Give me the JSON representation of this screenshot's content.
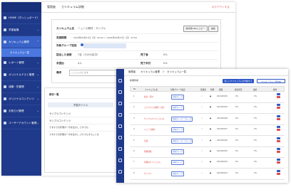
{
  "back_window": {
    "sidebar": {
      "items": [
        {
          "label": "HOME（ダッシュボード）"
        },
        {
          "label": "学習者機"
        },
        {
          "label": "カリキュラム管理"
        },
        {
          "label": "レポート管理"
        },
        {
          "label": "オリジナルテスト管理"
        },
        {
          "label": "成績・先管理"
        },
        {
          "label": "オリジナルコンテンツ"
        },
        {
          "label": "お知らせ管理"
        },
        {
          "label": "ユーザーアカウント管理"
        }
      ],
      "sub_item": "カリキュラム一覧"
    },
    "header": {
      "breadcrumb": "管理者　　カリキュラム詳細",
      "logout": "ログアウトする"
    },
    "detail": {
      "curriculum_name_label": "カリキュラム名",
      "curriculum_name_value": "ニュース教材・サンプル",
      "period_label": "実施期間",
      "period_value": "2024年09月27日（日）00:00 ～ 2024年10月27日（日）23:59",
      "group_label": "対象グループ設定",
      "group_value": "",
      "submitted_label": "提出した者数",
      "submitted_value": "7名（3,000名中）",
      "completed_label": "完了者",
      "completed_value": "0%",
      "incomplete_label": "未提出",
      "incomplete_value": "4人",
      "unfinished_label": "完了未付",
      "unfinished_value": "0%",
      "note_label": "備考",
      "note_value": "ここに入力します",
      "copy_button": "操作用URLにコピー",
      "edit_button": "編集",
      "save_button": "保存を実施"
    },
    "list_panel": {
      "title": "教材一覧",
      "column_header": "学習タイトル",
      "rows": [
        "サンプルコンテンツ",
        "サンプルコンテンツ",
        "ですかでの影響の一方を生かし どれでも",
        "ですかでの影響の一方を生かし どれでもすることを"
      ]
    }
  },
  "front_window": {
    "breadcrumb": "管理者　　カリキュラム管理　＞　カリキュラム一覧",
    "new_button": "新規作成",
    "primary_button": "新しいカリキュラムを作成する",
    "secondary_button": "カリキュラム一括作成",
    "table": {
      "headers": [
        "No",
        "カリキュラム名",
        "対象グループ設定",
        "受講者",
        "状態",
        "期間",
        "提出状況",
        "進捗",
        "操作"
      ],
      "rows": [
        {
          "no": "1",
          "name": "政治・国力",
          "tag": "対象グループ",
          "date": "2024/09/30",
          "num": "0%"
        },
        {
          "no": "2",
          "name": "コンクル入力関係（2度）",
          "tag": "対象グループ",
          "date": "2024/09/29",
          "num": "0%"
        },
        {
          "no": "3",
          "name": "サンプルカリキュラム分",
          "tag": "対象グループ・グループ",
          "date": "2024/09/28",
          "num": "0%"
        },
        {
          "no": "4",
          "name": "ニュース教材",
          "tag": "対象グループ",
          "date": "2024/09/27",
          "num": "0%"
        },
        {
          "no": "5",
          "name": "英語",
          "tag": "対象グループ・グループ",
          "date": "2024/09/26",
          "num": "0%"
        },
        {
          "no": "6",
          "name": "算数問題",
          "tag": "対象グループ",
          "date": "2024/09/25",
          "num": "0%"
        },
        {
          "no": "7",
          "name": "新教材カリキュラム",
          "tag": "対象グループ",
          "date": "2024/09/24",
          "num": "0%"
        },
        {
          "no": "8",
          "name": "サンプル",
          "tag": "対象グループ",
          "date": "2024/09/23",
          "num": "0%"
        }
      ]
    }
  },
  "colors": {
    "sidebar": "#1f3a8a",
    "accent": "#3963c9",
    "primary_button": "#2d56c6",
    "link_red": "#e04848"
  }
}
